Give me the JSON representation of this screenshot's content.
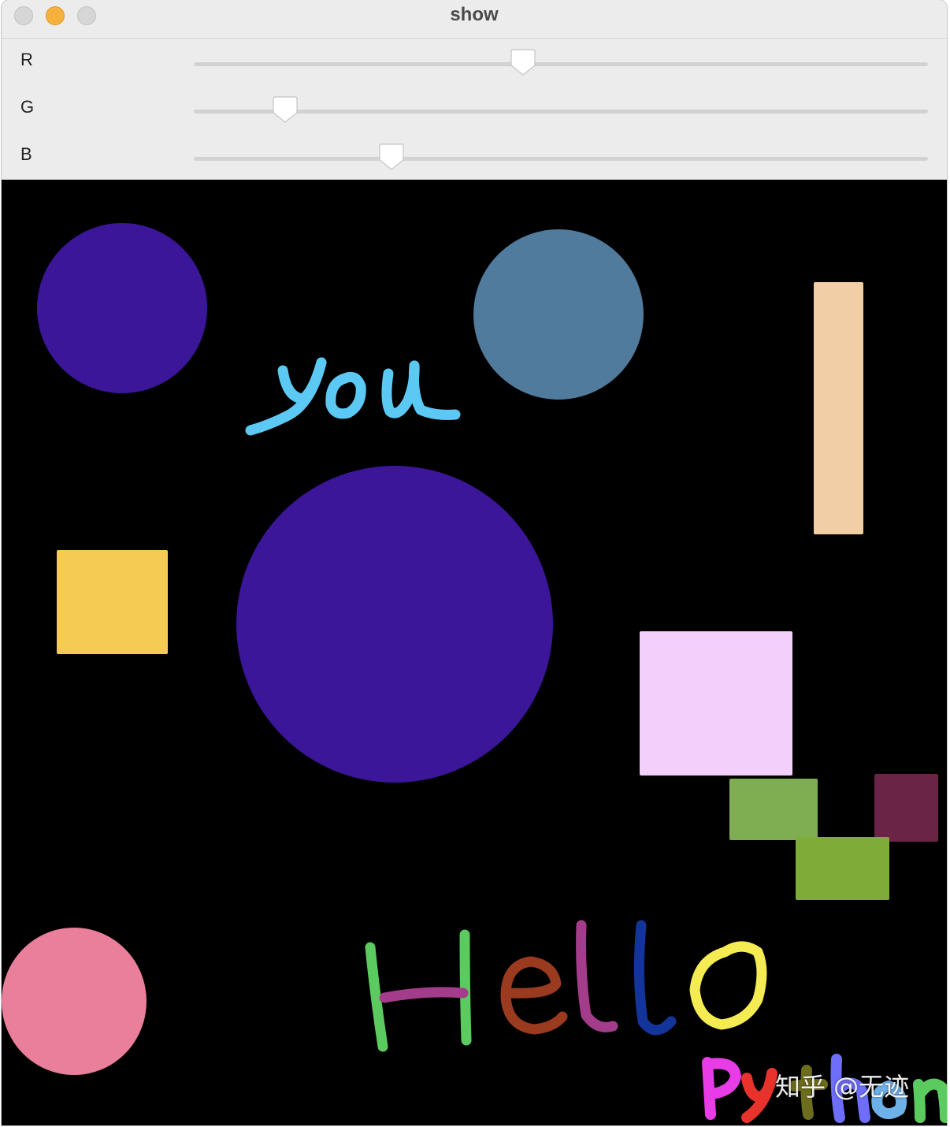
{
  "window": {
    "title": "show"
  },
  "sliders": [
    {
      "label": "R",
      "value_fraction": 0.448
    },
    {
      "label": "G",
      "value_fraction": 0.124
    },
    {
      "label": "B",
      "value_fraction": 0.269
    }
  ],
  "canvas": {
    "background": "#000000",
    "shape_colors": {
      "circle_top_left": "#3b1699",
      "circle_top_center": "#517b9d",
      "rect_tall_right": "#f2cea6",
      "rect_yellow": "#f5cb53",
      "circle_large": "#3b1699",
      "rect_light_pink": "#f3cffb",
      "rect_green_a": "#7fad52",
      "rect_maroon": "#6a2445",
      "rect_green_b": "#7fab38",
      "circle_pink": "#ea7f9b"
    },
    "handwriting": {
      "you_color": "#5cc9f5",
      "hello_colors": [
        "#5ccb5f",
        "#a33d8b",
        "#9a3a1e",
        "#a33d8b",
        "#13349b",
        "#f5eb52"
      ],
      "python_colors": [
        "#e83ce6",
        "#e8322c",
        "#6d6d1e",
        "#6e6efb",
        "#6eb0e8",
        "#5ccb5f"
      ]
    },
    "watermark": "知乎 @无迹"
  }
}
